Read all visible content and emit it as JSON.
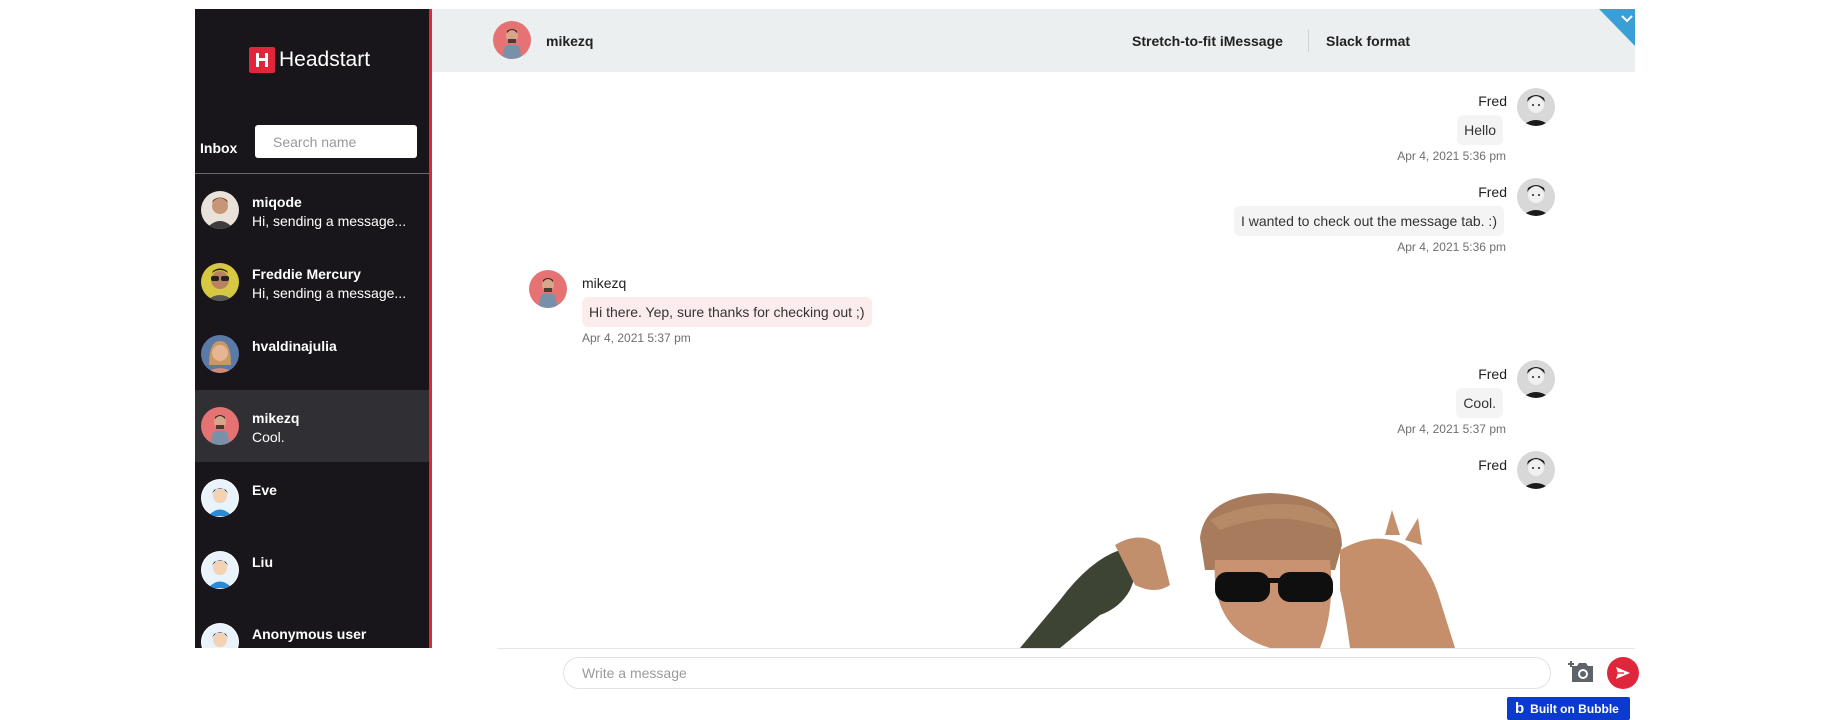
{
  "brand": {
    "name": "Headstart",
    "accent": "#e0263a"
  },
  "sidebar": {
    "inbox_label": "Inbox",
    "search_placeholder": "Search name",
    "contacts": [
      {
        "name": "miqode",
        "preview": "Hi, sending a message..."
      },
      {
        "name": "Freddie Mercury",
        "preview": "Hi, sending a message..."
      },
      {
        "name": "hvaldinajulia",
        "preview": ""
      },
      {
        "name": "mikezq",
        "preview": "Cool.",
        "active": true
      },
      {
        "name": "Eve",
        "preview": ""
      },
      {
        "name": "Liu",
        "preview": ""
      },
      {
        "name": "Anonymous user",
        "preview": ""
      }
    ]
  },
  "header": {
    "title": "mikezq",
    "imessage_label": "Stretch-to-fit iMessage",
    "slack_label": "Slack format"
  },
  "messages": [
    {
      "sender": "Fred",
      "text": "Hello",
      "time": "Apr 4, 2021 5:36 pm",
      "direction": "outgoing"
    },
    {
      "sender": "Fred",
      "text": "I wanted to check out the message tab. :)",
      "time": "Apr 4, 2021 5:36 pm",
      "direction": "outgoing"
    },
    {
      "sender": "mikezq",
      "text": "Hi there. Yep, sure thanks for checking out ;)",
      "time": "Apr 4, 2021 5:37 pm",
      "direction": "incoming"
    },
    {
      "sender": "Fred",
      "text": "Cool.",
      "time": "Apr 4, 2021 5:37 pm",
      "direction": "outgoing"
    },
    {
      "sender": "Fred",
      "text": "",
      "time": "",
      "direction": "outgoing",
      "attachment": "gif-image"
    }
  ],
  "composer": {
    "placeholder": "Write a message"
  },
  "badge": {
    "label": "Built on Bubble"
  }
}
